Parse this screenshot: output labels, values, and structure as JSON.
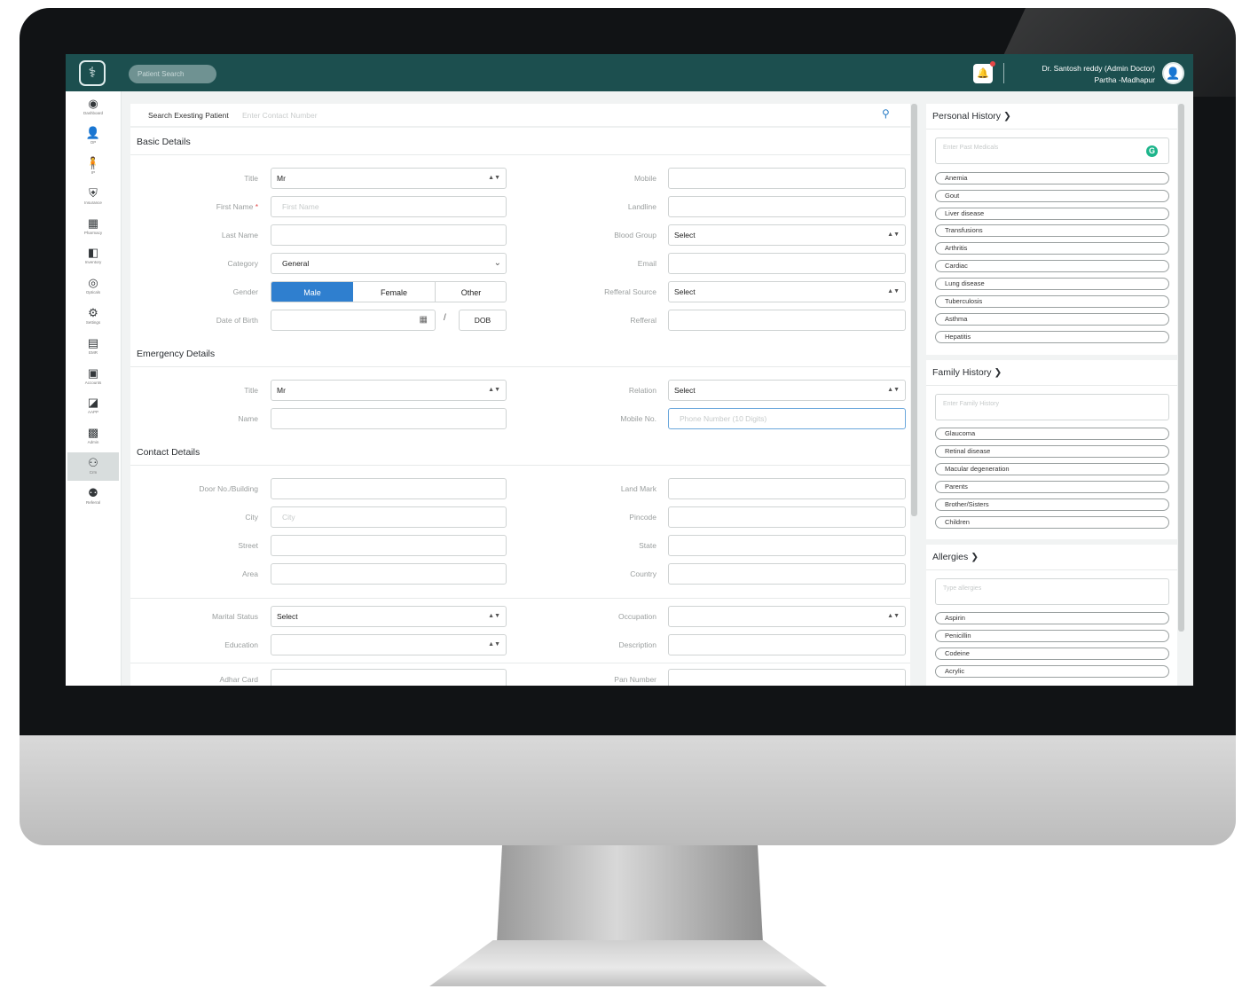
{
  "topbar": {
    "logo_glyph": "⚕",
    "patient_search_placeholder": "Patient Search",
    "bell_glyph": "🔔",
    "user_name": "Dr. Santosh reddy (Admin Doctor)",
    "user_location": "Partha -Madhapur",
    "avatar_glyph": "👤",
    "colors": {
      "bar": "#1c4f4f",
      "accent": "#2f7fcf"
    }
  },
  "sidebar": {
    "items": [
      {
        "label": "Dashboard",
        "icon": "dashboard-icon",
        "glyph": "◉"
      },
      {
        "label": "OP",
        "icon": "op-icon",
        "glyph": "👤"
      },
      {
        "label": "IP",
        "icon": "ip-icon",
        "glyph": "🧍"
      },
      {
        "label": "Insurance",
        "icon": "insurance-icon",
        "glyph": "⛨"
      },
      {
        "label": "Pharmacy",
        "icon": "pharmacy-icon",
        "glyph": "▦"
      },
      {
        "label": "Inventory",
        "icon": "inventory-icon",
        "glyph": "◧"
      },
      {
        "label": "Opticals",
        "icon": "opticals-icon",
        "glyph": "◎"
      },
      {
        "label": "Settings",
        "icon": "settings-icon",
        "glyph": "⚙"
      },
      {
        "label": "EMR",
        "icon": "emr-icon",
        "glyph": "▤"
      },
      {
        "label": "Accounts",
        "icon": "accounts-icon",
        "glyph": "▣"
      },
      {
        "label": "AAPP",
        "icon": "aapp-icon",
        "glyph": "◪"
      },
      {
        "label": "Admin",
        "icon": "admin-icon",
        "glyph": "▩"
      },
      {
        "label": "Crm",
        "icon": "crm-icon",
        "glyph": "⚇"
      },
      {
        "label": "Referral",
        "icon": "referral-icon",
        "glyph": "⚉"
      }
    ]
  },
  "search": {
    "label": "Search Exesting Patient",
    "placeholder": "Enter Contact Number"
  },
  "basic": {
    "section": "Basic Details",
    "title_label": "Title",
    "title_value": "Mr",
    "first_name_label": "First Name",
    "first_name_placeholder": "First Name",
    "last_name_label": "Last Name",
    "category_label": "Category",
    "category_value": "General",
    "gender_label": "Gender",
    "gender_options": [
      "Male",
      "Female",
      "Other"
    ],
    "gender_selected": "Male",
    "dob_label": "Date of Birth",
    "dob_separator": "/",
    "dob_button": "DOB",
    "mobile_label": "Mobile",
    "landline_label": "Landline",
    "blood_group_label": "Blood Group",
    "blood_group_value": "Select",
    "email_label": "Email",
    "referral_source_label": "Refferal Source",
    "referral_source_value": "Select",
    "referral_label": "Refferal"
  },
  "emergency": {
    "section": "Emergency Details",
    "title_label": "Title",
    "title_value": "Mr",
    "name_label": "Name",
    "relation_label": "Relation",
    "relation_value": "Select",
    "mobile_label": "Mobile No.",
    "mobile_placeholder": "Phone Number (10 Digits)"
  },
  "contact": {
    "section": "Contact Details",
    "door_label": "Door No./Building",
    "city_label": "City",
    "city_placeholder": "City",
    "street_label": "Street",
    "area_label": "Area",
    "landmark_label": "Land Mark",
    "pincode_label": "Pincode",
    "state_label": "State",
    "country_label": "Country",
    "marital_label": "Marital Status",
    "marital_value": "Select",
    "education_label": "Education",
    "occupation_label": "Occupation",
    "description_label": "Description",
    "adhar_label": "Adhar Card",
    "pan_label": "Pan Number"
  },
  "right": {
    "personal": {
      "title": "Personal History",
      "placeholder": "Enter Past Medicals",
      "items": [
        "Anemia",
        "Gout",
        "Liver disease",
        "Transfusions",
        "Arthritis",
        "Cardiac",
        "Lung disease",
        "Tuberculosis",
        "Asthma",
        "Hepatitis"
      ]
    },
    "family": {
      "title": "Family History",
      "placeholder": "Enter Family History",
      "items": [
        "Glaucoma",
        "Retinal disease",
        "Macular degeneration",
        "Parents",
        "Brother/Sisters",
        "Children"
      ]
    },
    "allergies": {
      "title": "Allergies",
      "placeholder": "Type allergies",
      "items": [
        "Aspirin",
        "Penicillin",
        "Codeine",
        "Acrylic"
      ]
    }
  }
}
